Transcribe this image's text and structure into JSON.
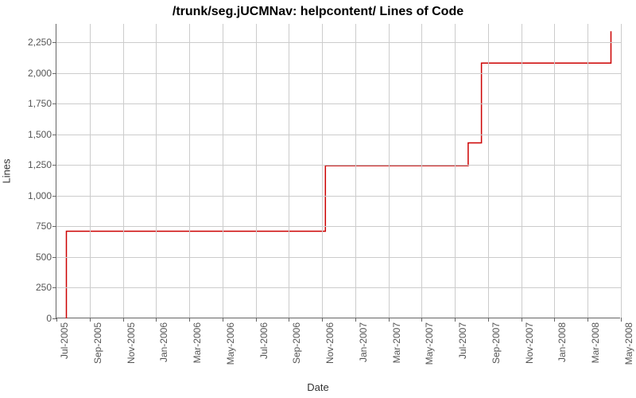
{
  "chart_data": {
    "type": "line",
    "title": "/trunk/seg.jUCMNav: helpcontent/ Lines of Code",
    "xlabel": "Date",
    "ylabel": "Lines",
    "ylim": [
      0,
      2400
    ],
    "y_ticks": [
      0,
      250,
      500,
      750,
      1000,
      1250,
      1500,
      1750,
      2000,
      2250
    ],
    "y_tick_labels": [
      "0",
      "250",
      "500",
      "750",
      "1,000",
      "1,250",
      "1,500",
      "1,750",
      "2,000",
      "2,250"
    ],
    "x_tick_months": [
      0,
      2,
      4,
      6,
      8,
      10,
      12,
      14,
      16,
      18,
      20,
      22,
      24,
      26,
      28,
      30,
      32,
      34
    ],
    "x_tick_labels": [
      "Jul-2005",
      "Sep-2005",
      "Nov-2005",
      "Jan-2006",
      "Mar-2006",
      "May-2006",
      "Jul-2006",
      "Sep-2006",
      "Nov-2006",
      "Jan-2007",
      "Mar-2007",
      "May-2007",
      "Jul-2007",
      "Sep-2007",
      "Nov-2007",
      "Jan-2008",
      "Mar-2008",
      "May-2008"
    ],
    "x_range_months": [
      0,
      34
    ],
    "series": [
      {
        "name": "Lines of Code",
        "color": "#cc0000",
        "points": [
          {
            "month": 0.6,
            "value": 0
          },
          {
            "month": 0.6,
            "value": 710
          },
          {
            "month": 16.2,
            "value": 710
          },
          {
            "month": 16.2,
            "value": 1245
          },
          {
            "month": 24.8,
            "value": 1245
          },
          {
            "month": 24.8,
            "value": 1430
          },
          {
            "month": 25.6,
            "value": 1430
          },
          {
            "month": 25.6,
            "value": 2080
          },
          {
            "month": 33.4,
            "value": 2080
          },
          {
            "month": 33.4,
            "value": 2340
          }
        ]
      }
    ]
  }
}
